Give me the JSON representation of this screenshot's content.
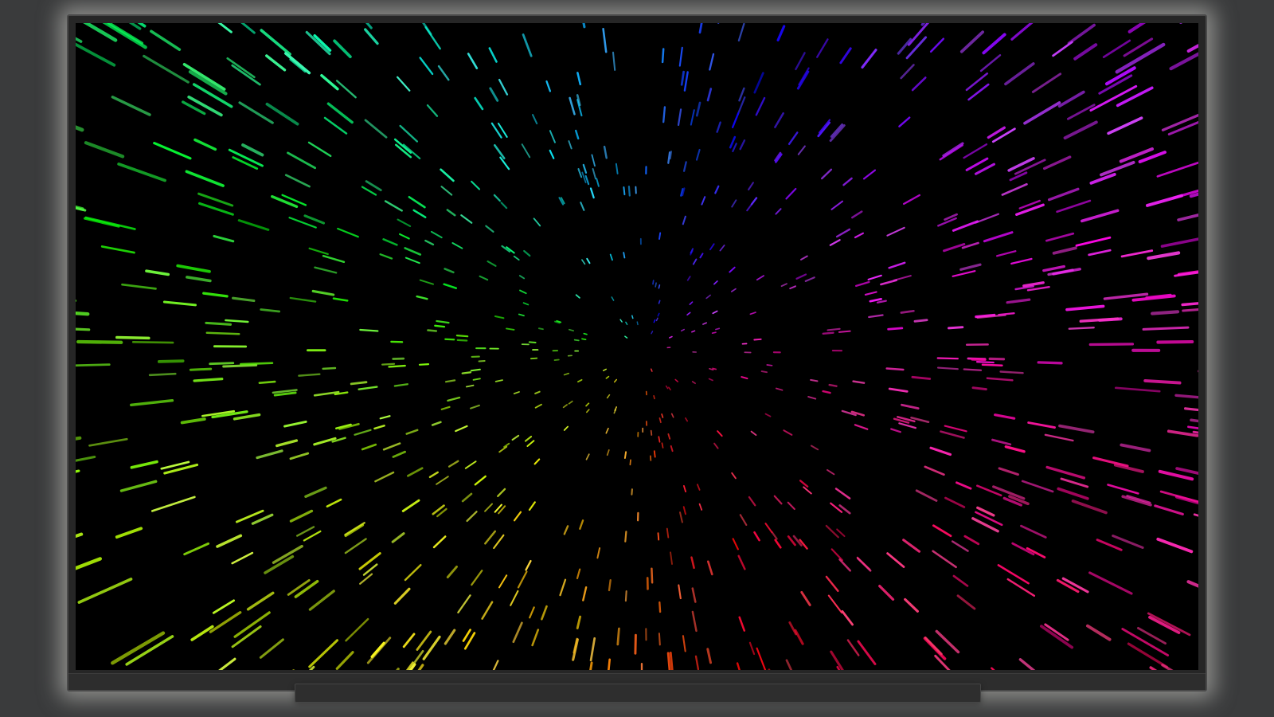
{
  "scene": {
    "screen_content": "hyperspace-starfield",
    "palette": {
      "screen_background": "#000000",
      "frame": "#262626",
      "wall": "#3a3b3c",
      "glow": "#cdcdc8"
    },
    "streak_hue_order": [
      "cyan",
      "blue",
      "violet",
      "magenta",
      "red",
      "orange",
      "yellow",
      "green"
    ]
  }
}
